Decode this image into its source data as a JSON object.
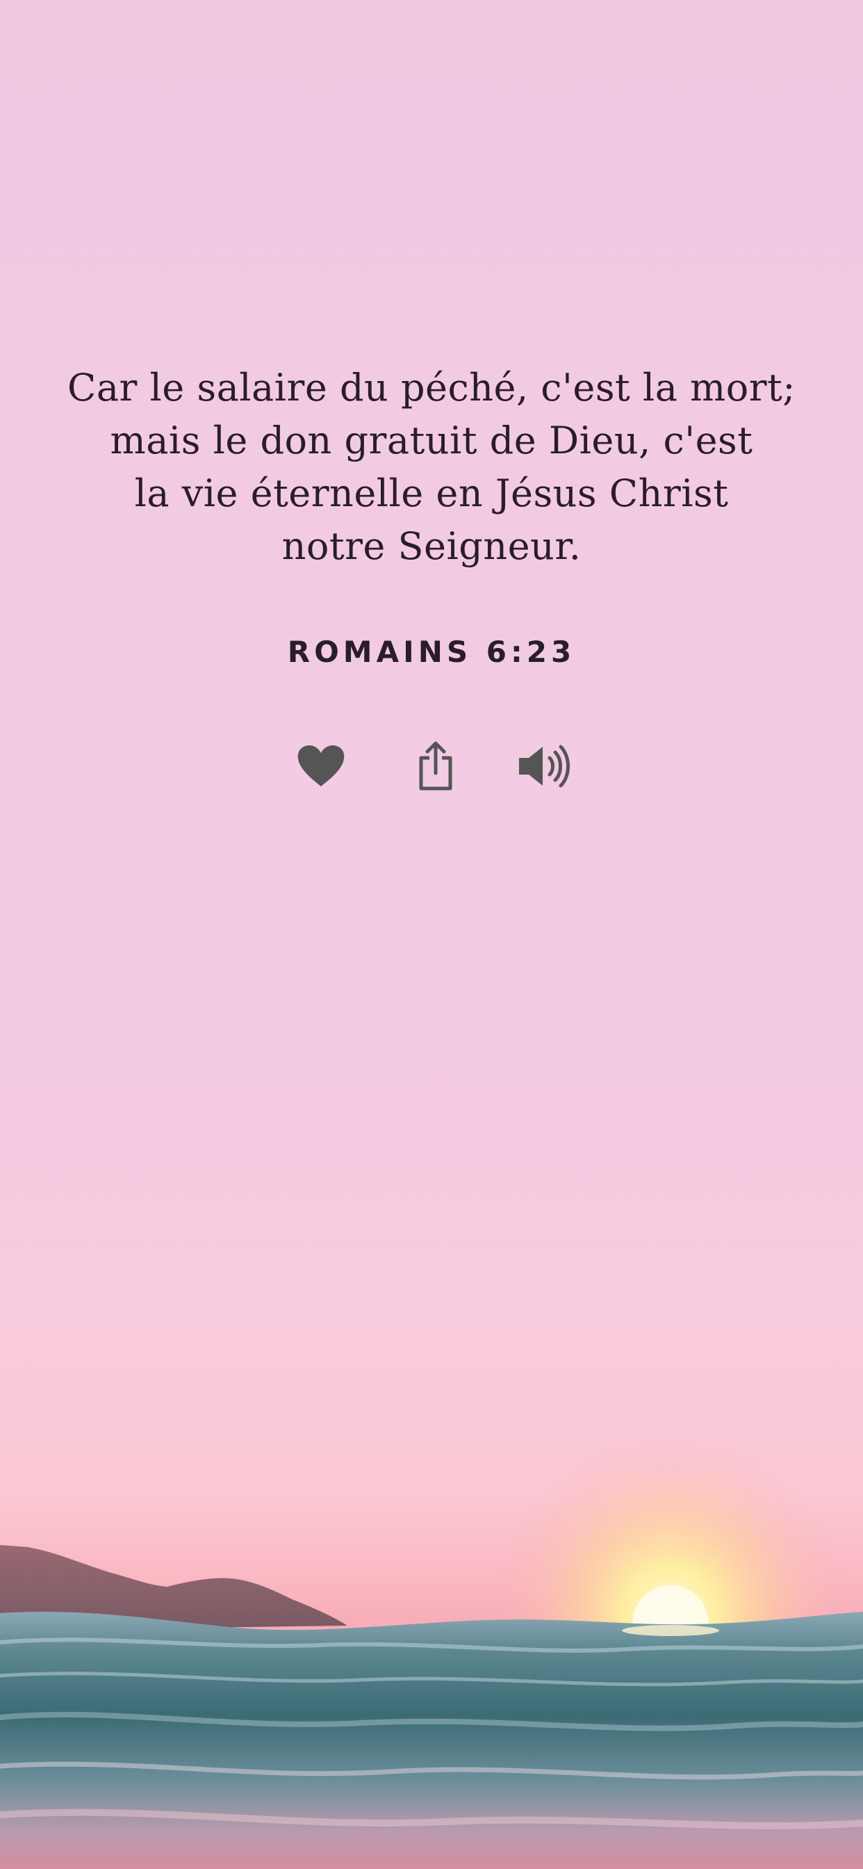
{
  "verse": {
    "lines": [
      "Car le salaire du péché, c'est la mort;",
      "mais le don gratuit de Dieu, c'est",
      "la vie éternelle en Jésus Christ",
      "notre Seigneur."
    ],
    "reference": "ROMAINS 6:23"
  },
  "actions": [
    {
      "name": "favorite",
      "icon": "heart-icon"
    },
    {
      "name": "share",
      "icon": "share-icon"
    },
    {
      "name": "listen",
      "icon": "speaker-icon"
    }
  ],
  "colors": {
    "text": "#2a1d28",
    "icon": "#555555",
    "sky_top": "#efcae1",
    "horizon": "#f7a8b2",
    "sun": "#fff7b0",
    "sea": "#3f6f78"
  }
}
